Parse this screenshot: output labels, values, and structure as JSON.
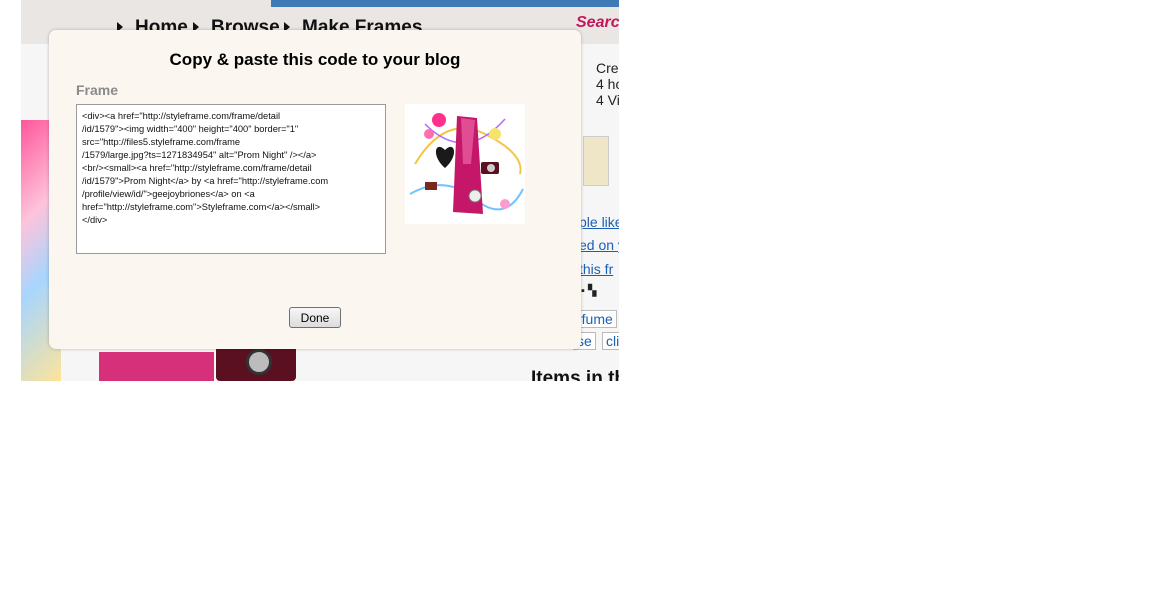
{
  "background": {
    "nav": {
      "items": [
        "Home",
        "Browse",
        "Make Frames"
      ],
      "search_label": "Search"
    },
    "stats_lines": [
      "Crea",
      "4 ho",
      "4 Vi"
    ],
    "links": [
      "ple like",
      "ed on y",
      "this fr"
    ],
    "tags": [
      "rfume",
      "se",
      "cli"
    ],
    "items_heading": "Items in th"
  },
  "modal": {
    "title": "Copy & paste this code to your blog",
    "section_label": "Frame",
    "embed_code": "<div><a href=\"http://styleframe.com/frame/detail\n/id/1579\"><img width=\"400\" height=\"400\" border=\"1\"\nsrc=\"http://files5.styleframe.com/frame\n/1579/large.jpg?ts=1271834954\" alt=\"Prom Night\" /></a>\n<br/><small><a href=\"http://styleframe.com/frame/detail\n/id/1579\">Prom Night</a> by <a href=\"http://styleframe.com\n/profile/view/id/\">geejoybriones</a> on <a\nhref=\"http://styleframe.com\">Styleframe.com</a></small>\n</div>",
    "done_label": "Done"
  },
  "colors": {
    "topbar": "#3f7ab7",
    "modal_bg": "#fbf6f0",
    "search_accent": "#c2185b",
    "link": "#1a5fb4"
  }
}
